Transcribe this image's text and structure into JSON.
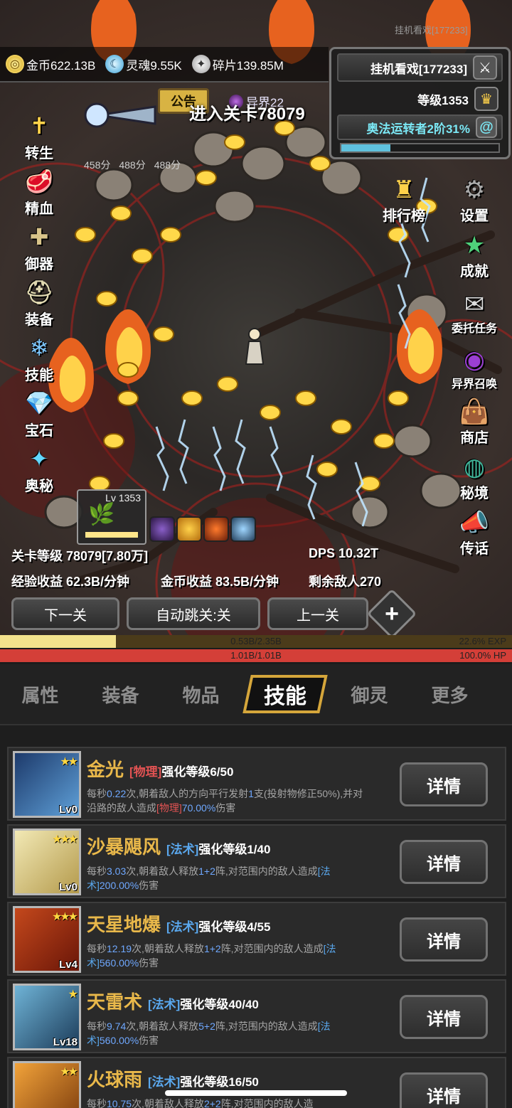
{
  "top_faint": "挂机看戏[177233]",
  "resources": {
    "gold": "金币622.13B",
    "soul": "灵魂9.55K",
    "fragment": "碎片139.85M"
  },
  "idle_panel": {
    "title": "挂机看戏[177233]",
    "level": "等级1353",
    "arcane": "奥法运转者2阶31%",
    "arcane_progress": 0.31
  },
  "notice_label": "公告",
  "other_world": "异界22",
  "enter_stage": "进入关卡78079",
  "scores": [
    "458分",
    "488分",
    "488分"
  ],
  "left_menu": [
    {
      "label": "转生",
      "icon": "✝"
    },
    {
      "label": "精血",
      "icon": "🥩"
    },
    {
      "label": "御器",
      "icon": "✚"
    },
    {
      "label": "装备",
      "icon": "⛑"
    },
    {
      "label": "技能",
      "icon": "❄"
    },
    {
      "label": "宝石",
      "icon": "💎"
    },
    {
      "label": "奥秘",
      "icon": "✦"
    }
  ],
  "rank_label": "排行榜",
  "right_menu": [
    {
      "label": "设置",
      "icon": "⚙"
    },
    {
      "label": "成就",
      "icon": "★"
    },
    {
      "label": "委托任务",
      "icon": "✉"
    },
    {
      "label": "异界召唤",
      "icon": "◉"
    },
    {
      "label": "商店",
      "icon": "👜"
    },
    {
      "label": "秘境",
      "icon": "◍"
    },
    {
      "label": "传话",
      "icon": "📣"
    }
  ],
  "pet": {
    "level": "Lv 1353"
  },
  "stats": {
    "stage_level": "关卡等级 78079[7.80万]",
    "dps": "DPS 10.32T",
    "exp_income": "经验收益 62.3B/分钟",
    "gold_income": "金币收益 83.5B/分钟",
    "enemies_left": "剩余敌人270"
  },
  "nav": {
    "next": "下一关",
    "auto": "自动跳关:关",
    "prev": "上一关"
  },
  "exp_bar": {
    "text": "0.53B/2.35B",
    "right": "22.6% EXP",
    "fraction": 0.226
  },
  "hp_bar": {
    "text": "1.01B/1.01B",
    "right": "100.0%  HP",
    "fraction": 1.0
  },
  "tabs": [
    "属性",
    "装备",
    "物品",
    "技能",
    "御灵",
    "更多"
  ],
  "active_tab": "技能",
  "colors": {
    "accent": "#d5a63b",
    "skill_name": "#e9b84a",
    "physical": "#e25353",
    "magic": "#5aa8ee"
  },
  "skills": [
    {
      "name": "金光",
      "tag": "[物理]",
      "enhance": "强化等级6/50",
      "lv": "Lv0",
      "stars": "★★",
      "desc_pre": "每秒",
      "desc_num": "0.22",
      "desc_mid": "次,朝着敌人的方向平行发射",
      "desc_count": "1",
      "desc_post": "支(投射物修正50%),并对沿路的敌人造成",
      "desc_tag": "[物理]",
      "desc_pct": "70.00%",
      "desc_end": "伤害",
      "detail": "详情"
    },
    {
      "name": "沙暴飓风",
      "tag": "[法术]",
      "enhance": "强化等级1/40",
      "lv": "Lv0",
      "stars": "★★★",
      "desc_pre": "每秒",
      "desc_num": "3.03",
      "desc_mid": "次,朝着敌人释放",
      "desc_count": "1+2",
      "desc_post": "阵,对范围内的敌人造成",
      "desc_tag": "[法术]",
      "desc_pct": "200.00%",
      "desc_end": "伤害",
      "detail": "详情"
    },
    {
      "name": "天星地爆",
      "tag": "[法术]",
      "enhance": "强化等级4/55",
      "lv": "Lv4",
      "stars": "★★★",
      "desc_pre": "每秒",
      "desc_num": "12.19",
      "desc_mid": "次,朝着敌人释放",
      "desc_count": "1+2",
      "desc_post": "阵,对范围内的敌人造成",
      "desc_tag": "[法术]",
      "desc_pct": "560.00%",
      "desc_end": "伤害",
      "detail": "详情"
    },
    {
      "name": "天雷术",
      "tag": "[法术]",
      "enhance": "强化等级40/40",
      "lv": "Lv18",
      "stars": "★",
      "desc_pre": "每秒",
      "desc_num": "9.74",
      "desc_mid": "次,朝着敌人释放",
      "desc_count": "5+2",
      "desc_post": "阵,对范围内的敌人造成",
      "desc_tag": "[法术]",
      "desc_pct": "560.00%",
      "desc_end": "伤害",
      "detail": "详情"
    },
    {
      "name": "火球雨",
      "tag": "[法术]",
      "enhance": "强化等级16/50",
      "lv": "",
      "stars": "★★",
      "desc_pre": "每秒",
      "desc_num": "10.75",
      "desc_mid": "次,朝着敌人释放",
      "desc_count": "2+2",
      "desc_post": "阵,对范围内的敌人造",
      "desc_tag": "",
      "desc_pct": "",
      "desc_end": "",
      "detail": "详情"
    }
  ]
}
